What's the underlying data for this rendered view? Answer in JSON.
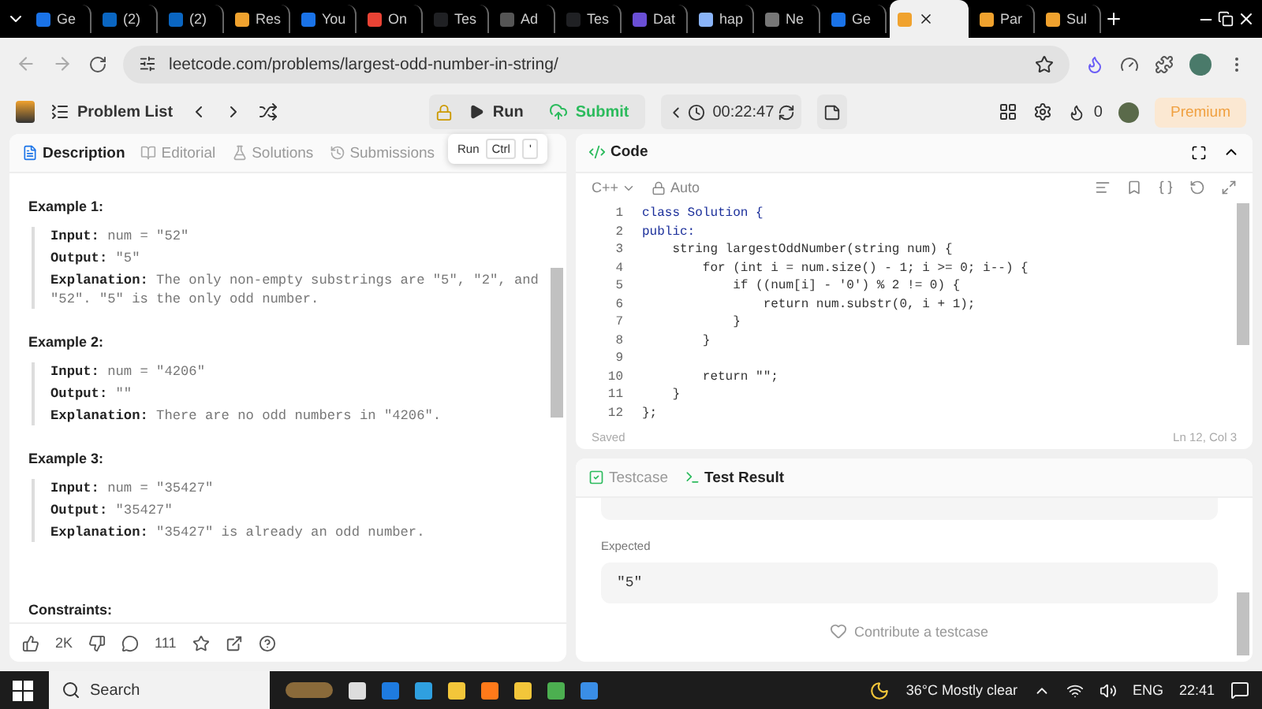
{
  "browser": {
    "tabs": [
      {
        "label": "Ge",
        "color": "#1a73e8",
        "selected": false
      },
      {
        "label": "(2)",
        "color": "#0a66c2",
        "selected": false
      },
      {
        "label": "(2)",
        "color": "#0a66c2",
        "selected": false
      },
      {
        "label": "Res",
        "color": "#f0a22e",
        "selected": false
      },
      {
        "label": "You",
        "color": "#1a73e8",
        "selected": false
      },
      {
        "label": "On",
        "color": "#ea4335",
        "selected": false
      },
      {
        "label": "Tes",
        "color": "#202124",
        "selected": false
      },
      {
        "label": "Ad",
        "color": "#555555",
        "selected": false
      },
      {
        "label": "Tes",
        "color": "#202124",
        "selected": false
      },
      {
        "label": "Dat",
        "color": "#6a4fd6",
        "selected": false
      },
      {
        "label": "hap",
        "color": "#8ab4f8",
        "selected": false
      },
      {
        "label": "Ne",
        "color": "#777777",
        "selected": false
      },
      {
        "label": "Ge",
        "color": "#1a73e8",
        "selected": false
      },
      {
        "color": "#f0a22e",
        "selected": true
      },
      {
        "label": "Par",
        "color": "#f0a22e",
        "selected": false
      },
      {
        "label": "Sul",
        "color": "#f0a22e",
        "selected": false
      }
    ],
    "url": "leetcode.com/problems/largest-odd-number-in-string/"
  },
  "header": {
    "problem_list": "Problem List",
    "run": "Run",
    "submit": "Submit",
    "timer": "00:22:47",
    "streak": "0",
    "premium": "Premium"
  },
  "tooltip": {
    "label": "Run",
    "keys": [
      "Ctrl",
      "'"
    ]
  },
  "left_panel": {
    "tabs": [
      {
        "label": "Description",
        "selected": true
      },
      {
        "label": "Editorial",
        "selected": false
      },
      {
        "label": "Solutions",
        "selected": false
      },
      {
        "label": "Submissions",
        "selected": false
      }
    ],
    "examples": [
      {
        "title": "Example 1:",
        "lines": [
          "**Input:** num = \"52\"",
          "**Output:** \"5\"",
          "**Explanation:** The only non-empty substrings are \"5\", \"2\", and \"52\". \"5\" is the only odd number."
        ]
      },
      {
        "title": "Example 2:",
        "lines": [
          "**Input:** num = \"4206\"",
          "**Output:** \"\"",
          "**Explanation:** There are no odd numbers in \"4206\"."
        ]
      },
      {
        "title": "Example 3:",
        "lines": [
          "**Input:** num = \"35427\"",
          "**Output:** \"35427\"",
          "**Explanation:** \"35427\" is already an odd number."
        ]
      }
    ],
    "constraints_title": "Constraints:",
    "footer": {
      "likes": "2K",
      "comments": "111"
    }
  },
  "editor": {
    "title": "Code",
    "language": "C++",
    "mode": "Auto",
    "lines": [
      {
        "number": "1",
        "code": "class Solution {"
      },
      {
        "number": "2",
        "code": "public:"
      },
      {
        "number": "3",
        "code": "    string largestOddNumber(string num) {"
      },
      {
        "number": "4",
        "code": "        for (int i = num.size() - 1; i >= 0; i--) {"
      },
      {
        "number": "5",
        "code": "            if ((num[i] - '0') % 2 != 0) {"
      },
      {
        "number": "6",
        "code": "                return num.substr(0, i + 1);"
      },
      {
        "number": "7",
        "code": "            }"
      },
      {
        "number": "8",
        "code": "        }"
      },
      {
        "number": "9"
      },
      {
        "number": "10",
        "code": "        return \"\";"
      },
      {
        "number": "11",
        "code": "    }"
      },
      {
        "number": "12",
        "code": "};"
      }
    ],
    "status": "Saved",
    "position": "Ln 12, Col 3"
  },
  "results": {
    "tabs": [
      {
        "label": "Testcase",
        "selected": false
      },
      {
        "label": "Test Result",
        "selected": true
      }
    ],
    "expected_label": "Expected",
    "expected_value": "\"5\"",
    "contribute": "Contribute a testcase"
  },
  "taskbar": {
    "search": "Search",
    "weather": "36°C  Mostly clear",
    "language": "ENG",
    "time": "22:41"
  }
}
